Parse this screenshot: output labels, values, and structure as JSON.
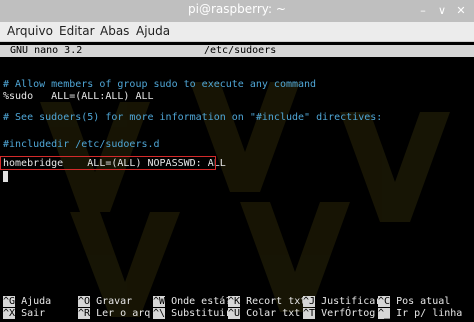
{
  "window": {
    "title": "pi@raspberry: ~",
    "minimize_glyph": "–",
    "maximize_glyph": "∨",
    "close_glyph": "✕"
  },
  "menu": {
    "items": [
      "Arquivo",
      "Editar",
      "Abas",
      "Ajuda"
    ]
  },
  "nano": {
    "version": "GNU nano 3.2",
    "filename": "/etc/sudoers"
  },
  "content": {
    "lines": [
      "# Allow members of group sudo to execute any command",
      "%sudo   ALL=(ALL:ALL) ALL",
      "# See sudoers(5) for more information on \"#include\" directives:",
      "#includedir /etc/sudoers.d",
      "homebridge    ALL=(ALL) NOPASSWD: ALL"
    ]
  },
  "shortcuts": [
    {
      "key": "^G",
      "label": " Ajuda"
    },
    {
      "key": "^O",
      "label": " Gravar"
    },
    {
      "key": "^W",
      "label": " Onde está?"
    },
    {
      "key": "^K",
      "label": " Recort txt"
    },
    {
      "key": "^J",
      "label": " Justificar"
    },
    {
      "key": "^C",
      "label": " Pos atual"
    },
    {
      "key": "^X",
      "label": " Sair"
    },
    {
      "key": "^R",
      "label": " Ler o arq"
    },
    {
      "key": "^\\",
      "label": " Substituir"
    },
    {
      "key": "^U",
      "label": " Colar txt"
    },
    {
      "key": "^T",
      "label": " VerfÓrtog"
    },
    {
      "key": "^_",
      "label": " Ir p/ linha"
    }
  ],
  "colors": {
    "titlebar": "#bfbfbf",
    "terminal_bg": "#000000",
    "comment": "#4fa6d6",
    "highlight_box": "#d32a2a"
  }
}
